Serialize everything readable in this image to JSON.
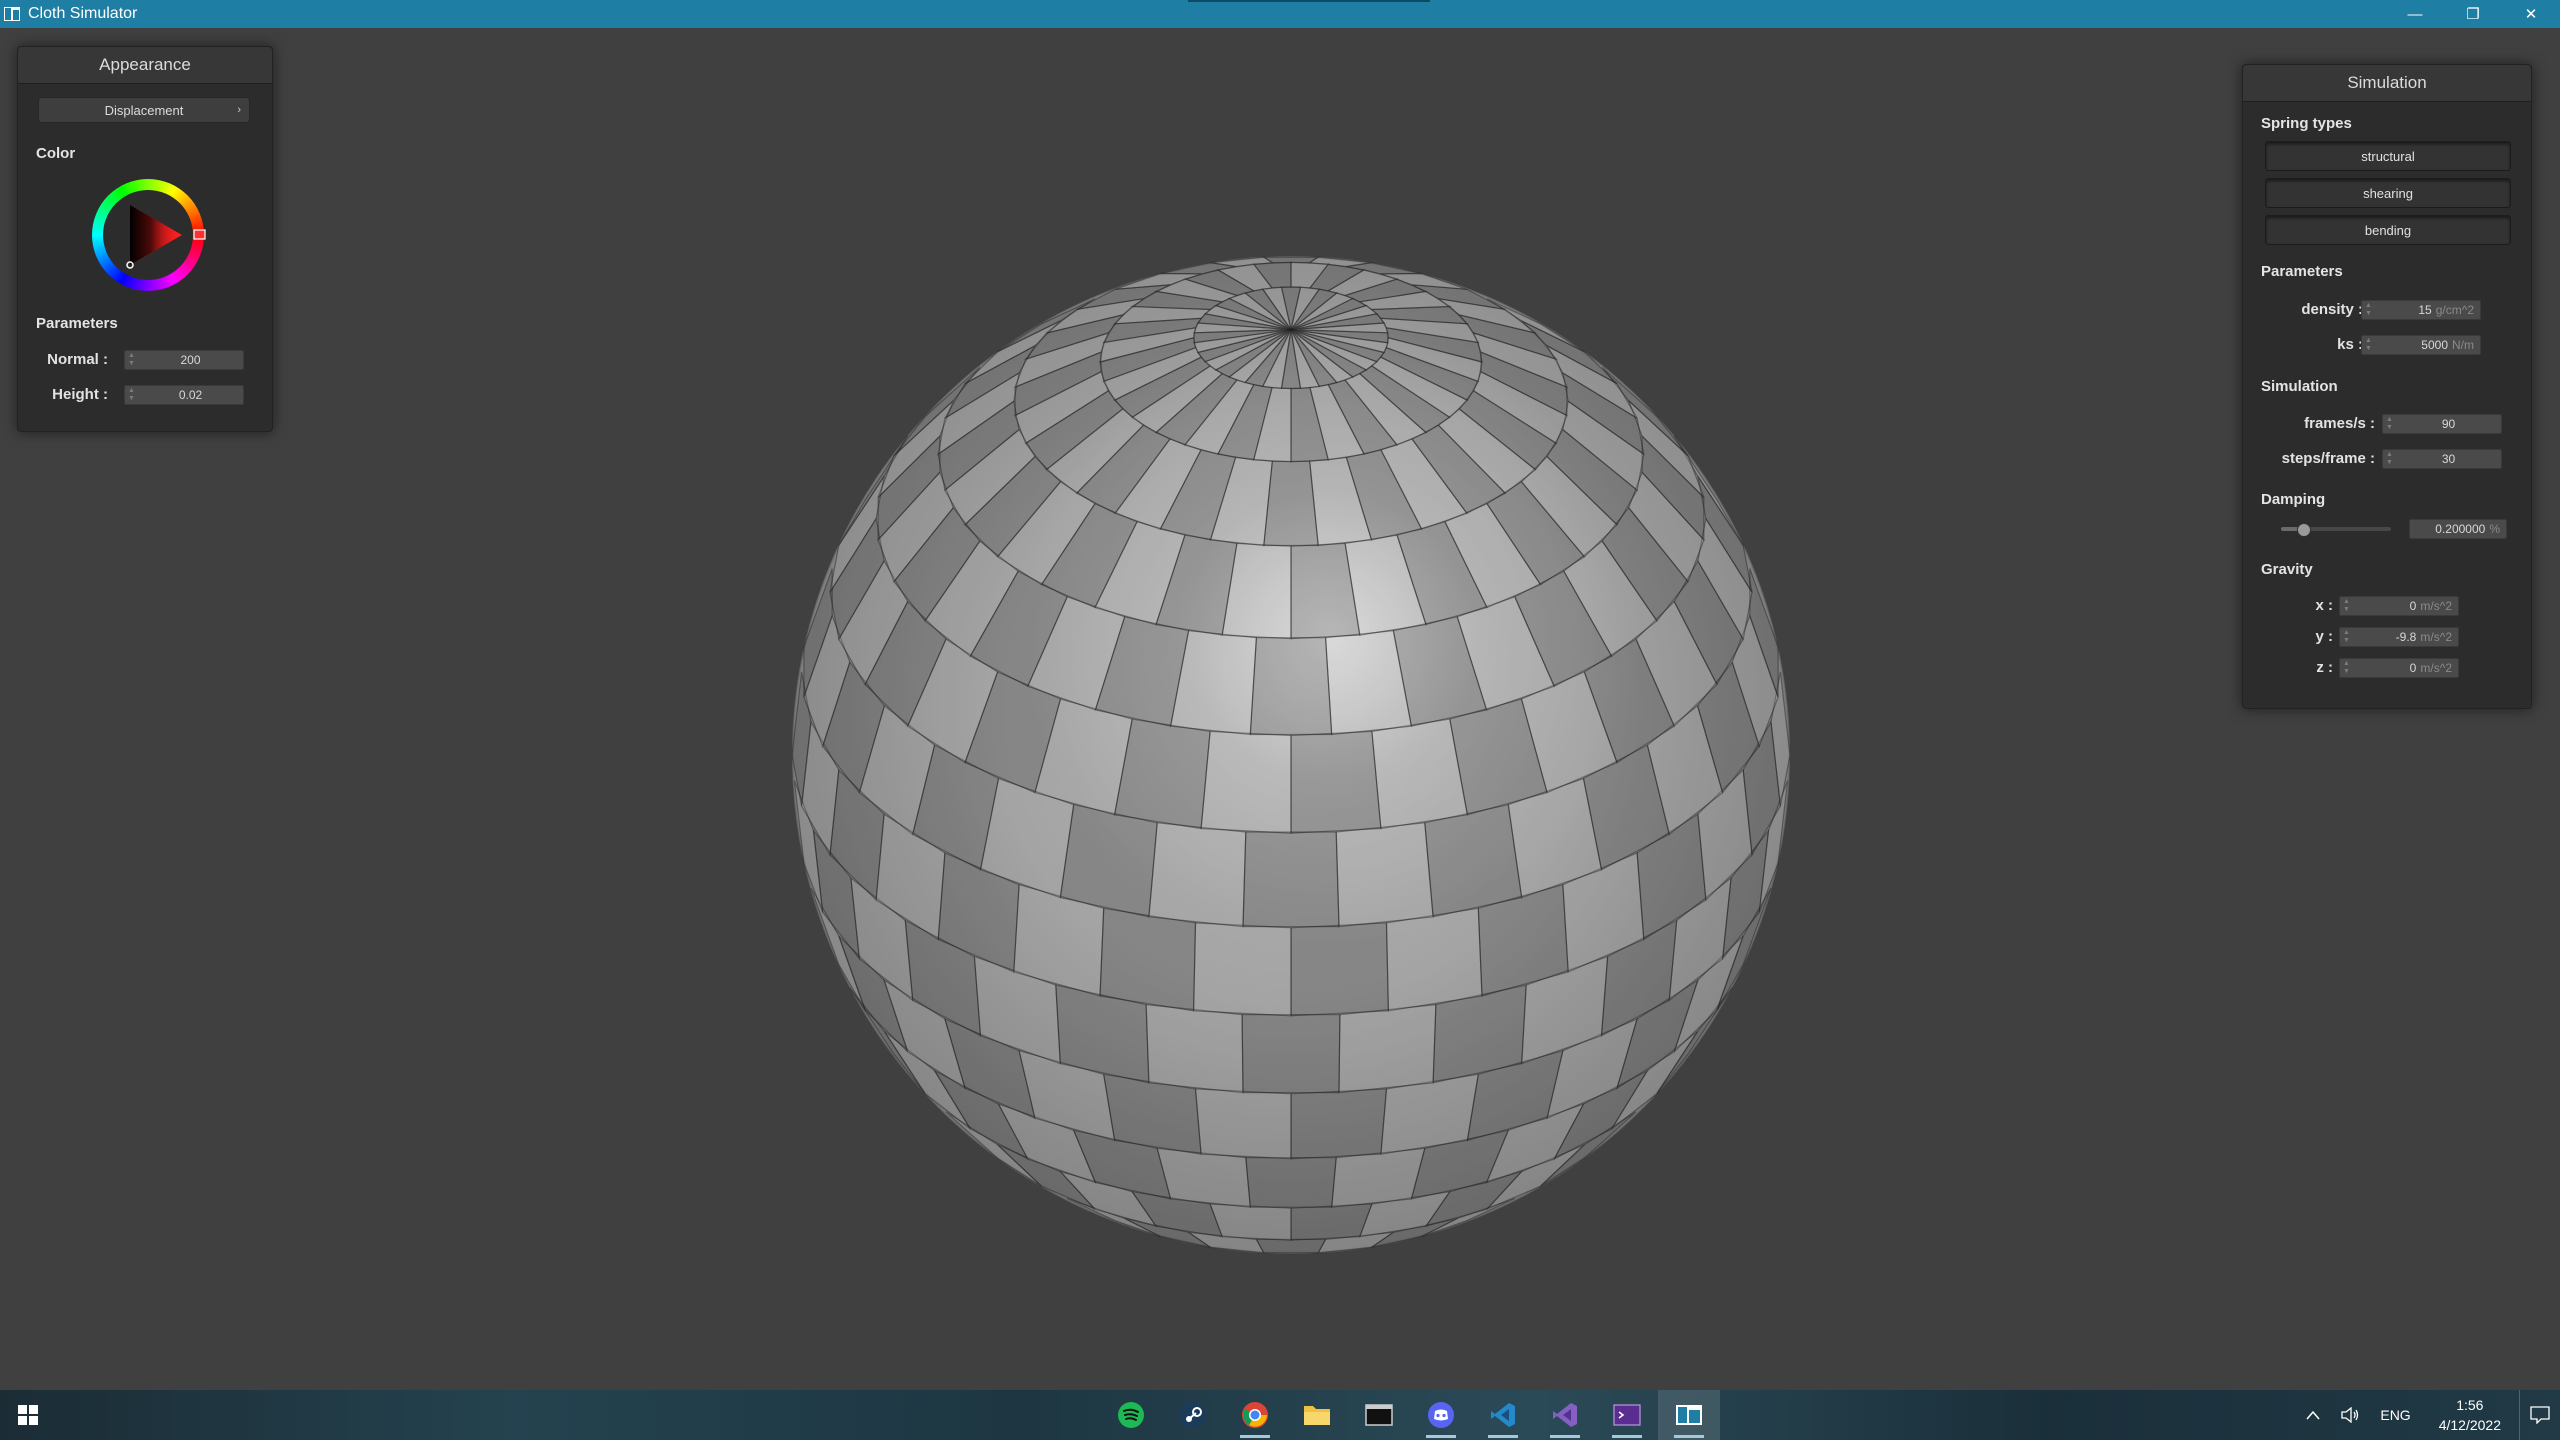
{
  "window": {
    "title": "Cloth Simulator",
    "minimize": "—",
    "maximize": "❐",
    "close": "✕"
  },
  "appearance": {
    "header": "Appearance",
    "shader_select": "Displacement",
    "color_label": "Color",
    "selected_color": "#ff3030",
    "parameters_label": "Parameters",
    "normal": {
      "label": "Normal :",
      "value": "200"
    },
    "height": {
      "label": "Height :",
      "value": "0.02"
    }
  },
  "simulation": {
    "header": "Simulation",
    "spring_types_label": "Spring types",
    "springs": [
      "structural",
      "shearing",
      "bending"
    ],
    "parameters_label": "Parameters",
    "density": {
      "label": "density :",
      "value": "15",
      "unit": "g/cm^2"
    },
    "ks": {
      "label": "ks :",
      "value": "5000",
      "unit": "N/m"
    },
    "simulation_label": "Simulation",
    "fps": {
      "label": "frames/s :",
      "value": "90"
    },
    "steps": {
      "label": "steps/frame :",
      "value": "30"
    },
    "damping_label": "Damping",
    "damping": {
      "value": "0.200000",
      "unit": "%",
      "level": 0.2
    },
    "gravity_label": "Gravity",
    "gx": {
      "label": "x :",
      "value": "0",
      "unit": "m/s^2"
    },
    "gy": {
      "label": "y :",
      "value": "-9.8",
      "unit": "m/s^2"
    },
    "gz": {
      "label": "z :",
      "value": "0",
      "unit": "m/s^2"
    }
  },
  "taskbar": {
    "apps": [
      "spotify-icon",
      "steam-icon",
      "chrome-icon",
      "file-explorer-icon",
      "terminal-icon",
      "discord-icon",
      "vscode-icon",
      "visual-studio-icon",
      "terminal-purple-icon",
      "cloth-simulator-icon"
    ],
    "language": "ENG",
    "time": "1:56",
    "date": "4/12/2022"
  }
}
